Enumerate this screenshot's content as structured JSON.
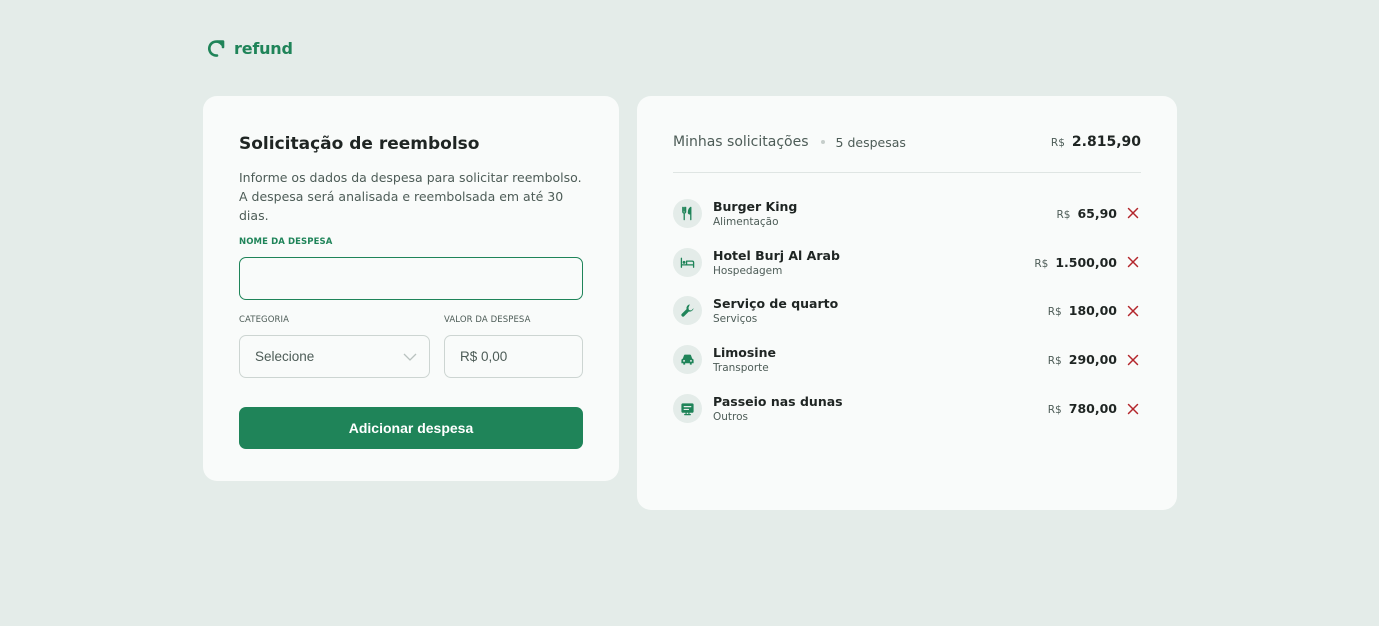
{
  "brand": {
    "name": "refund",
    "icon": "refresh-arrow-icon",
    "color": "#1f8459"
  },
  "form": {
    "title": "Solicitação de reembolso",
    "description": "Informe os dados da despesa para solicitar reembolso. A despesa será analisada e reembolsada em até 30 dias.",
    "name_label": "NOME DA DESPESA",
    "name_value": "",
    "category_label": "CATEGORIA",
    "category_selected": "Selecione",
    "amount_label": "VALOR DA DESPESA",
    "amount_placeholder": "R$ 0,00",
    "submit_label": "Adicionar despesa"
  },
  "list": {
    "title": "Minhas solicitações",
    "count": "5 despesas",
    "total_currency": "R$",
    "total_value": "2.815,90",
    "items": [
      {
        "name": "Burger King",
        "category": "Alimentação",
        "currency": "R$",
        "value": "65,90",
        "icon": "fork-knife-icon"
      },
      {
        "name": "Hotel Burj Al Arab",
        "category": "Hospedagem",
        "currency": "R$",
        "value": "1.500,00",
        "icon": "bed-icon"
      },
      {
        "name": "Serviço de quarto",
        "category": "Serviços",
        "currency": "R$",
        "value": "180,00",
        "icon": "wrench-icon"
      },
      {
        "name": "Limosine",
        "category": "Transporte",
        "currency": "R$",
        "value": "290,00",
        "icon": "car-icon"
      },
      {
        "name": "Passeio nas dunas",
        "category": "Outros",
        "currency": "R$",
        "value": "780,00",
        "icon": "receipt-icon"
      }
    ]
  },
  "colors": {
    "accent": "#1f8459",
    "danger": "#b3262c",
    "background": "#e4ece9",
    "card": "#f9fbfa"
  }
}
